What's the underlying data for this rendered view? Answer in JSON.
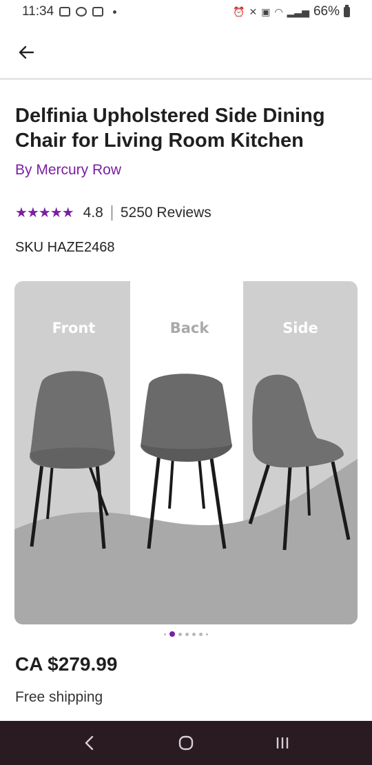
{
  "status_bar": {
    "time": "11:34",
    "battery": "66%"
  },
  "product": {
    "title": "Delfinia Upholstered Side Dining Chair for Living Room Kitchen",
    "brand": "By Mercury Row",
    "rating": "4.8",
    "stars": "★★★★★",
    "reviews": "5250 Reviews",
    "sku": "SKU HAZE2468",
    "price": "CA $279.99",
    "shipping": "Free shipping"
  },
  "image": {
    "labels": [
      "Front",
      "Back",
      "Side"
    ]
  },
  "carousel": {
    "active_index": 1,
    "count": 7
  },
  "colors": {
    "accent": "#7b1fa2",
    "nav_bar": "#2a1a22"
  },
  "icons": {
    "back": "arrow-left-icon",
    "nav_back": "chevron-left-icon",
    "nav_home": "home-circle-icon",
    "nav_recents": "recents-icon"
  }
}
